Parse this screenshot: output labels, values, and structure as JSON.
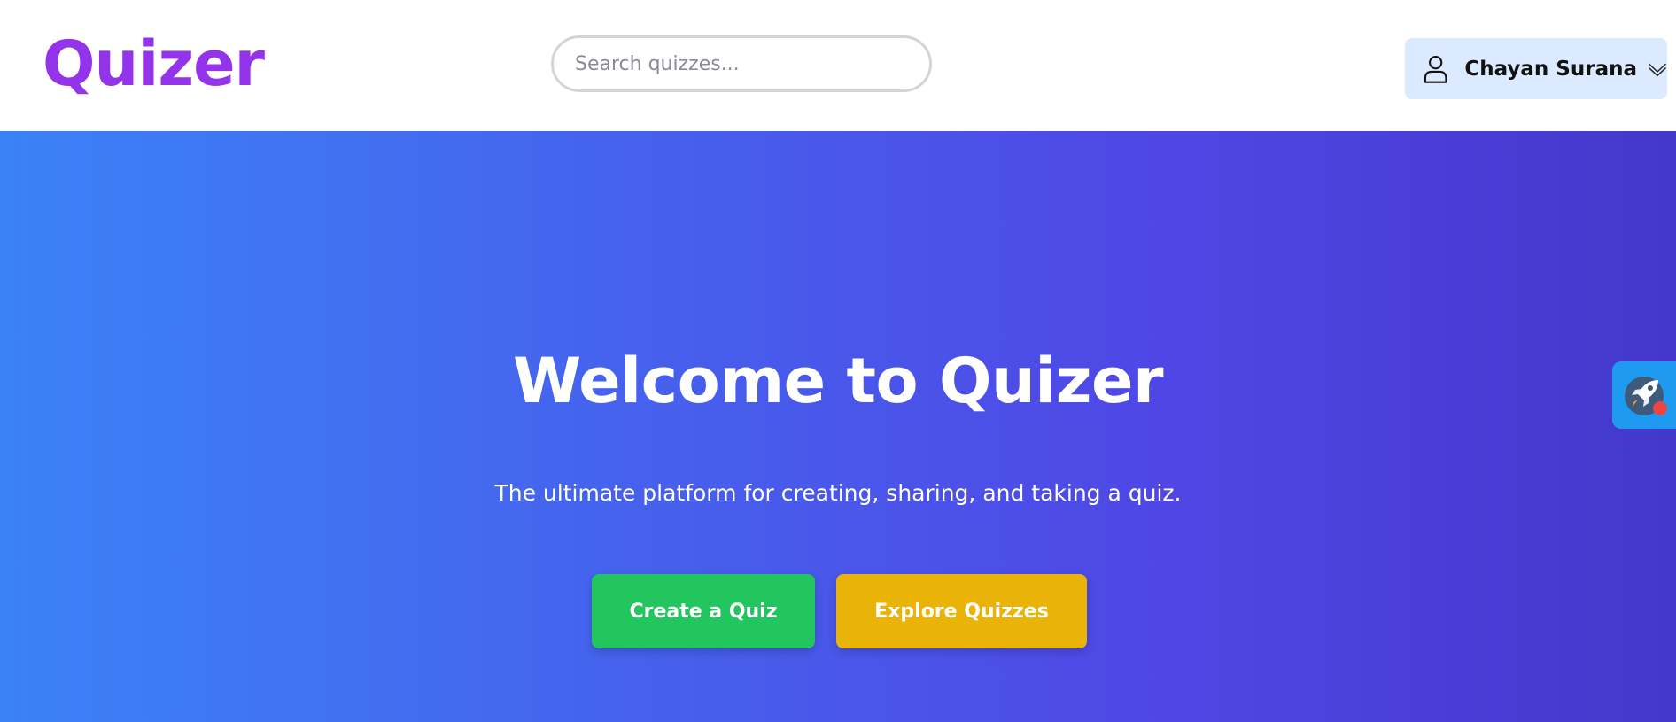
{
  "header": {
    "logo": "Quizer",
    "search": {
      "placeholder": "Search quizzes...",
      "value": ""
    },
    "user": {
      "name": "Chayan Surana",
      "icon": "user-icon",
      "dropdown_icon": "chevron-down-icon"
    }
  },
  "hero": {
    "title": "Welcome to Quizer",
    "subtitle": "The ultimate platform for creating, sharing, and taking a quiz.",
    "buttons": {
      "create": "Create a Quiz",
      "explore": "Explore Quizzes"
    }
  },
  "widget": {
    "icon": "rocket-icon",
    "has_notification": true
  },
  "colors": {
    "brand": "#9333ea",
    "hero_gradient_start": "#3b82f6",
    "hero_gradient_end": "#4338ca",
    "create_button": "#22c55e",
    "explore_button": "#eab308",
    "user_menu_bg": "#dbeafe",
    "widget_bg": "#1e9bf0",
    "notification_dot": "#ef4444"
  }
}
